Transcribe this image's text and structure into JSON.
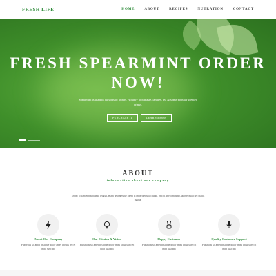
{
  "nav": {
    "logo": "FRESH LIFE",
    "items": [
      {
        "label": "HOME",
        "active": true
      },
      {
        "label": "ABOUT",
        "active": false
      },
      {
        "label": "RECIPES",
        "active": false
      },
      {
        "label": "NUTRATION",
        "active": false
      },
      {
        "label": "CONTACT",
        "active": false
      }
    ]
  },
  "hero": {
    "title_line1": "FRESH SPEARMINT ORDER",
    "title_line2": "NOW!",
    "subtitle": "Spearmint is used in all sorts of things. Notably toothpaste,candies, tea & some popular scented drinks.",
    "purchase_label": "PURCHASE IT",
    "learn_label": "LEARN MORE"
  },
  "about": {
    "title": "ABOUT",
    "subtitle": "information about our company",
    "text": "Donec a diam et nisl blandit feugiat, etiam pellentesque lorem at imperdiet sollicitudin. Sed et ante commodo, laoreet nulla nec mattis magna.",
    "features": [
      {
        "icon": "lightning-icon",
        "title": "About Our Company",
        "text": "Phasellus sit amet tristique dolor ames iaculis leo et nibh suscipit"
      },
      {
        "icon": "lightbulb-icon",
        "title": "Our Mission & Vision",
        "text": "Phasellus sit amet tristique dolor ames iaculis leo et nibh suscipit"
      },
      {
        "icon": "peace-hand-icon",
        "title": "Happy Customer",
        "text": "Phasellus sit amet tristique dolor ames iaculis leo et nibh suscipit"
      },
      {
        "icon": "microphone-icon",
        "title": "Quality Customer Support",
        "text": "Phasellus sit amet tristique dolor ames iaculis leo et nibh suscipit"
      }
    ]
  },
  "colors": {
    "accent": "#2e8b3a",
    "hero_green": "#3f8f2a"
  }
}
